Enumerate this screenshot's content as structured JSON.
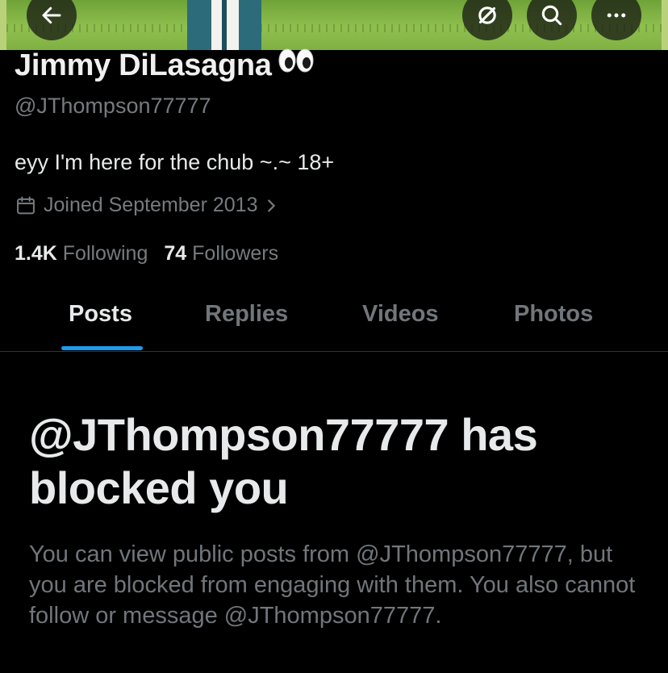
{
  "header": {
    "back_icon": "arrow-left-icon",
    "action_icons": [
      "repost-disabled-icon",
      "search-icon",
      "more-icon"
    ]
  },
  "profile": {
    "name": "Jimmy DiLasagna",
    "name_emoji": "eyes-emoji",
    "handle": "@JThompson77777",
    "bio": "eyy I'm here for the chub ~.~ 18+",
    "joined": "Joined September 2013",
    "following_count": "1.4K",
    "following_label": "Following",
    "followers_count": "74",
    "followers_label": "Followers"
  },
  "tabs": [
    {
      "label": "Posts",
      "active": true
    },
    {
      "label": "Replies",
      "active": false
    },
    {
      "label": "Videos",
      "active": false
    },
    {
      "label": "Photos",
      "active": false
    }
  ],
  "blocked": {
    "title": "@JThompson77777 has blocked you",
    "description": "You can view public posts from @JThompson77777, but you are blocked from engaging with them. You also cannot follow or message @JThompson77777."
  },
  "colors": {
    "background": "#000000",
    "accent": "#1d9bf0",
    "secondary_text": "#71767b",
    "primary_text": "#e7e9ea"
  }
}
